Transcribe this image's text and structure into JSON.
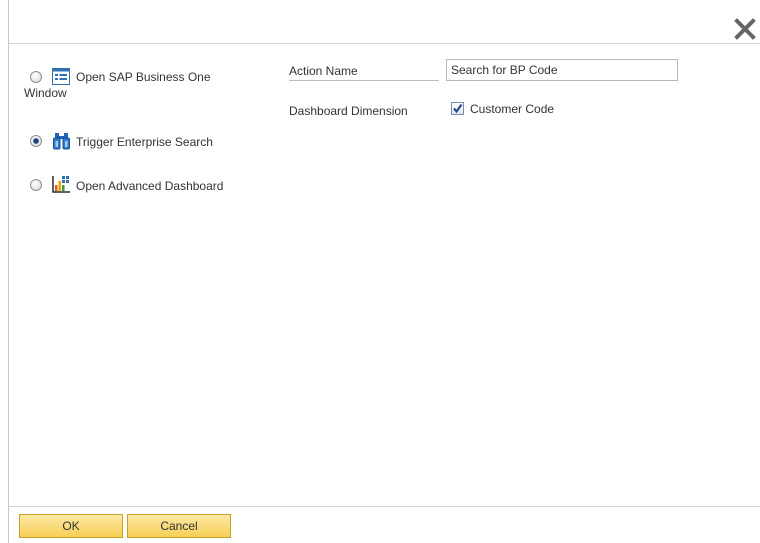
{
  "options": [
    {
      "label_line1": "Open SAP Business One",
      "label_line2": "Window",
      "icon": "window-icon",
      "selected": false
    },
    {
      "label": "Trigger Enterprise Search",
      "icon": "binoculars-icon",
      "selected": true
    },
    {
      "label": "Open Advanced Dashboard",
      "icon": "dashboard-icon",
      "selected": false
    }
  ],
  "form": {
    "action_name_label": "Action Name",
    "action_name_value": "Search for BP Code",
    "dashboard_dimension_label": "Dashboard Dimension",
    "customer_code_label": "Customer Code",
    "customer_code_checked": true
  },
  "buttons": {
    "ok_label": "OK",
    "cancel_label": "Cancel"
  },
  "colors": {
    "button_fill": "#f6cf55",
    "button_border": "#c9a227",
    "radio_selected": "#1f3b6e"
  }
}
